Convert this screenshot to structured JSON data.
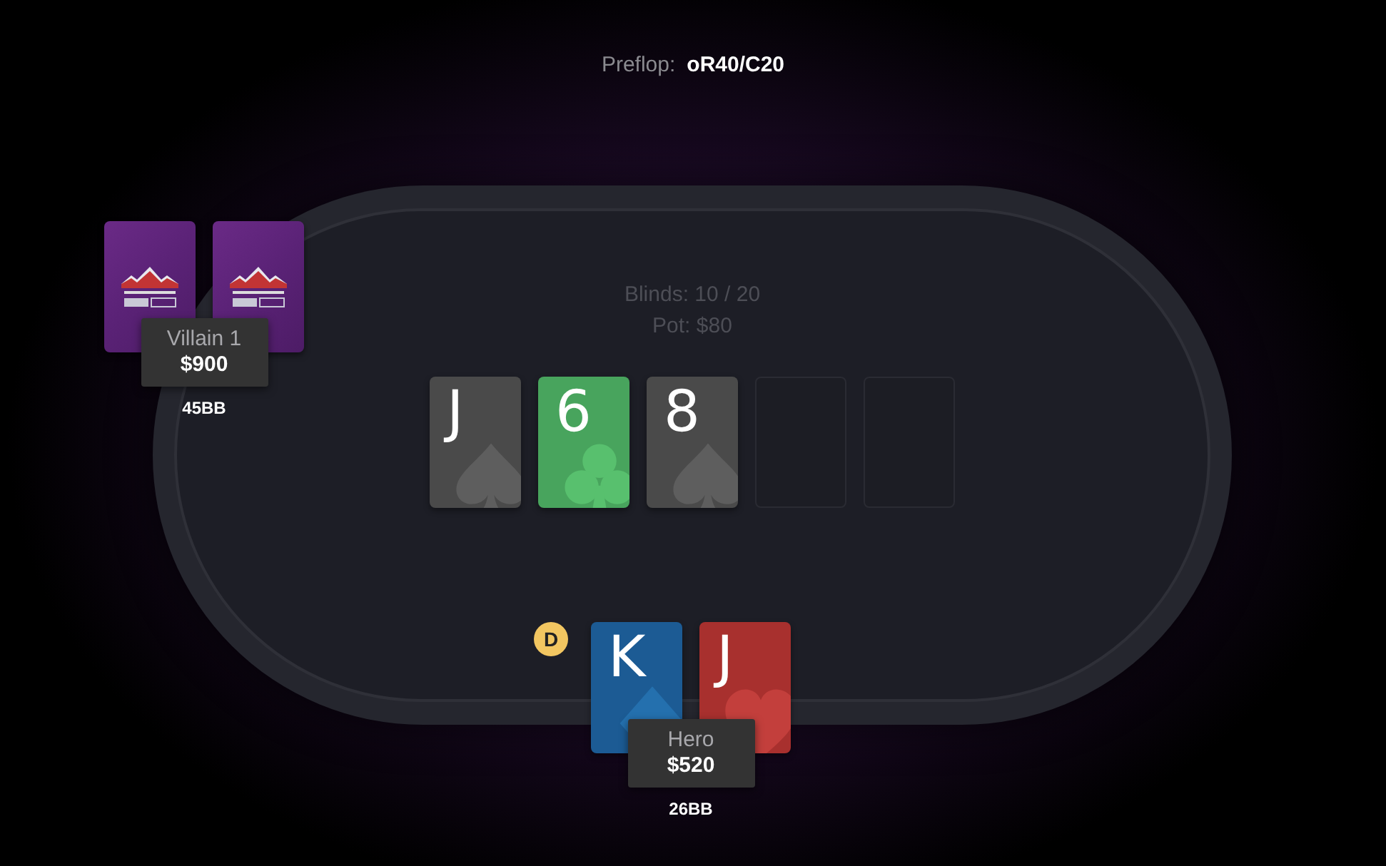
{
  "action": {
    "label": "Preflop:",
    "value": "oR40/C20"
  },
  "table": {
    "blinds": "Blinds: 10 / 20",
    "pot": "Pot: $80"
  },
  "board": [
    {
      "kind": "spade",
      "rank": "J"
    },
    {
      "kind": "club",
      "rank": "6"
    },
    {
      "kind": "spade",
      "rank": "8"
    },
    {
      "kind": "empty"
    },
    {
      "kind": "empty"
    }
  ],
  "players": [
    {
      "name": "Villain 1",
      "stack": "$900",
      "bb": "45BB",
      "dealer": false,
      "cards": [
        {
          "kind": "back"
        },
        {
          "kind": "back"
        }
      ]
    },
    {
      "name": "Hero",
      "stack": "$520",
      "bb": "26BB",
      "dealer": true,
      "dealer_label": "D",
      "cards": [
        {
          "kind": "diamond",
          "rank": "K"
        },
        {
          "kind": "heart",
          "rank": "J"
        }
      ]
    }
  ]
}
